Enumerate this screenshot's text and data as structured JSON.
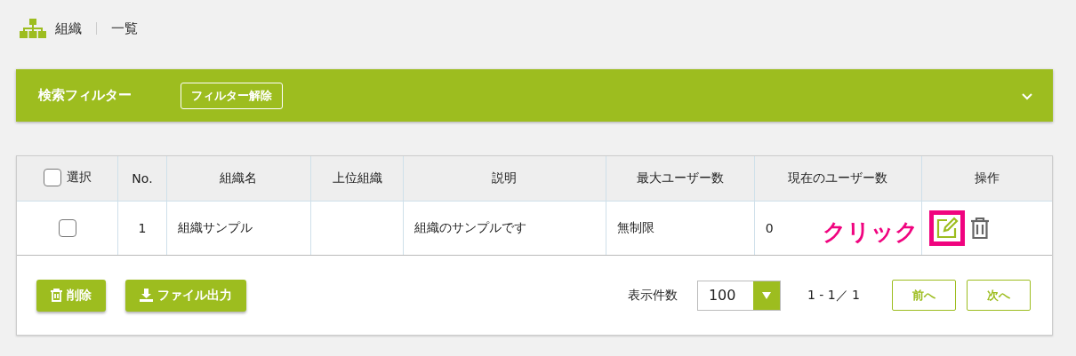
{
  "breadcrumb": {
    "section": "組織",
    "page": "一覧"
  },
  "filter": {
    "title": "検索フィルター",
    "clear_button": "フィルター解除",
    "expanded": false
  },
  "table": {
    "select_all": {
      "label": "選択",
      "checked": false
    },
    "columns": [
      "No.",
      "組織名",
      "上位組織",
      "説明",
      "最大ユーザー数",
      "現在のユーザー数",
      "操作"
    ],
    "rows": [
      {
        "checked": false,
        "no": "1",
        "name": "組織サンプル",
        "description": "組織のサンプルです",
        "max_users": "無制限",
        "current_users": "0",
        "edit_highlighted": true
      }
    ]
  },
  "annotation": {
    "text": "クリック"
  },
  "footer": {
    "buttons": [
      {
        "label": "削除",
        "kind": "delete"
      },
      {
        "label": "ファイル出力",
        "kind": "export"
      }
    ],
    "page_size_label": "表示件数",
    "page_size": "100",
    "range": "1 - 1／ 1",
    "prev": "前へ",
    "next": "次へ"
  }
}
